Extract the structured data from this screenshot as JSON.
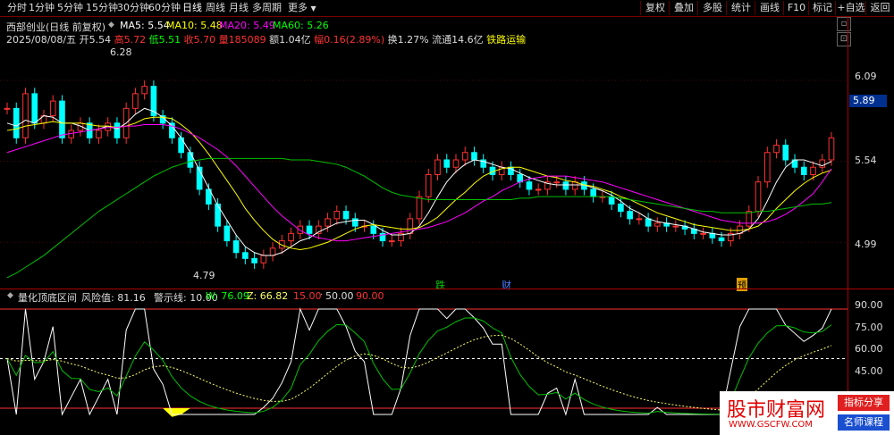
{
  "toolbar": {
    "timeframes": [
      "分时",
      "1分钟",
      "5分钟",
      "15分钟",
      "30分钟",
      "60分钟",
      "日线",
      "周线",
      "月线",
      "多周期",
      "更多"
    ],
    "active_timeframe": "日线",
    "buttons": [
      "复权",
      "叠加",
      "多股",
      "统计",
      "画线",
      "F10",
      "标记",
      "+自选",
      "返回"
    ]
  },
  "main_chart": {
    "stock_title": "西部创业(日线 前复权)",
    "ma_items": [
      {
        "label": "MA5: 5.54",
        "color": "#ffffff"
      },
      {
        "label": "MA10: 5.48",
        "color": "#ffff00"
      },
      {
        "label": "MA20: 5.49",
        "color": "#ff00ff"
      },
      {
        "label": "MA60: 5.26",
        "color": "#00ff00"
      }
    ],
    "info": {
      "date": "2025/08/08/五",
      "open_label": "开",
      "open": "5.54",
      "high_label": "高",
      "high": "5.72",
      "low_label": "低",
      "low": "5.51",
      "close_label": "收",
      "close": "5.70",
      "volume_label": "量",
      "volume": "185089",
      "amount_label": "额",
      "amount": "1.04亿",
      "change_label": "幅",
      "change": "0.16(2.89%)",
      "turnover": "换1.27%",
      "float": "流通14.6亿",
      "sector": "铁路运输"
    },
    "y_ticks": [
      "6.09",
      "5.54",
      "4.99"
    ],
    "current_price": "5.89",
    "high_mark": "6.28",
    "low_mark": "4.79",
    "event_tags": [
      {
        "text": "跌",
        "color": "#00cc00"
      },
      {
        "text": "财",
        "color": "#4a7dff"
      },
      {
        "text": "预",
        "color": "#cc8800"
      }
    ],
    "colors": {
      "up": "#ff3232",
      "down": "#00ffff",
      "ma5": "#ffffff",
      "ma10": "#ffff00",
      "ma20": "#ff00ff",
      "ma60": "#00c000"
    }
  },
  "indicator": {
    "name": "量化顶底区间",
    "risk": "风险值: 81.16",
    "warn": "警示线: 10.00",
    "w": "W: 76.09",
    "z": "Z: 66.82",
    "v15": "15.00",
    "v50": "50.00",
    "v90": "90.00",
    "y_ticks": [
      "90.00",
      "75.00",
      "60.00",
      "45.00"
    ]
  },
  "watermark": {
    "site": "股市财富网",
    "url": "WWW.GSCFW.COM",
    "tag1": "指标分享",
    "tag2": "名师课程"
  },
  "chart_data": {
    "type": "line",
    "title": "西部创业(日线 前复权)",
    "ylim": [
      4.7,
      6.4
    ],
    "close": [
      5.9,
      5.7,
      6.0,
      5.8,
      5.85,
      5.95,
      5.7,
      5.75,
      5.8,
      5.7,
      5.75,
      5.8,
      5.7,
      5.9,
      6.0,
      6.05,
      5.85,
      5.8,
      5.7,
      5.6,
      5.5,
      5.35,
      5.25,
      5.1,
      5.0,
      4.92,
      4.88,
      4.85,
      4.9,
      4.95,
      5.0,
      5.05,
      5.1,
      5.05,
      5.1,
      5.15,
      5.2,
      5.15,
      5.1,
      5.1,
      5.05,
      5.0,
      5.0,
      5.05,
      5.15,
      5.3,
      5.45,
      5.55,
      5.5,
      5.55,
      5.6,
      5.55,
      5.5,
      5.45,
      5.5,
      5.45,
      5.4,
      5.35,
      5.35,
      5.4,
      5.4,
      5.35,
      5.4,
      5.35,
      5.3,
      5.3,
      5.25,
      5.2,
      5.15,
      5.15,
      5.1,
      5.12,
      5.1,
      5.1,
      5.08,
      5.05,
      5.05,
      5.02,
      5.0,
      5.05,
      5.1,
      5.2,
      5.4,
      5.6,
      5.65,
      5.55,
      5.5,
      5.45,
      5.5,
      5.55,
      5.7
    ],
    "series": [
      {
        "name": "MA5",
        "values": [
          5.8,
          5.78,
          5.82,
          5.8,
          5.85,
          5.84,
          5.8,
          5.8,
          5.78,
          5.75,
          5.76,
          5.78,
          5.76,
          5.8,
          5.86,
          5.9,
          5.88,
          5.84,
          5.78,
          5.7,
          5.6,
          5.48,
          5.36,
          5.24,
          5.14,
          5.04,
          4.96,
          4.92,
          4.9,
          4.9,
          4.92,
          4.96,
          5.0,
          5.02,
          5.06,
          5.09,
          5.12,
          5.13,
          5.14,
          5.14,
          5.11,
          5.07,
          5.04,
          5.04,
          5.05,
          5.1,
          5.19,
          5.3,
          5.4,
          5.47,
          5.52,
          5.55,
          5.54,
          5.52,
          5.5,
          5.49,
          5.46,
          5.43,
          5.41,
          5.39,
          5.38,
          5.38,
          5.38,
          5.38,
          5.36,
          5.34,
          5.31,
          5.27,
          5.22,
          5.19,
          5.15,
          5.13,
          5.12,
          5.11,
          5.1,
          5.08,
          5.06,
          5.05,
          5.04,
          5.04,
          5.05,
          5.08,
          5.15,
          5.27,
          5.4,
          5.5,
          5.55,
          5.55,
          5.53,
          5.51,
          5.54
        ]
      },
      {
        "name": "MA10",
        "values": [
          5.75,
          5.76,
          5.78,
          5.79,
          5.8,
          5.81,
          5.8,
          5.8,
          5.8,
          5.79,
          5.78,
          5.78,
          5.77,
          5.78,
          5.8,
          5.83,
          5.84,
          5.84,
          5.83,
          5.79,
          5.74,
          5.67,
          5.59,
          5.5,
          5.41,
          5.32,
          5.22,
          5.14,
          5.07,
          5.01,
          4.97,
          4.95,
          4.94,
          4.95,
          4.97,
          4.99,
          5.02,
          5.05,
          5.08,
          5.1,
          5.11,
          5.1,
          5.09,
          5.08,
          5.08,
          5.09,
          5.12,
          5.16,
          5.22,
          5.28,
          5.33,
          5.39,
          5.44,
          5.47,
          5.49,
          5.5,
          5.5,
          5.48,
          5.46,
          5.44,
          5.43,
          5.41,
          5.4,
          5.38,
          5.37,
          5.35,
          5.33,
          5.3,
          5.28,
          5.25,
          5.22,
          5.19,
          5.17,
          5.15,
          5.13,
          5.11,
          5.1,
          5.09,
          5.08,
          5.07,
          5.07,
          5.08,
          5.1,
          5.15,
          5.22,
          5.28,
          5.34,
          5.39,
          5.43,
          5.46,
          5.48
        ]
      },
      {
        "name": "MA20",
        "values": [
          5.6,
          5.62,
          5.64,
          5.66,
          5.68,
          5.7,
          5.72,
          5.73,
          5.74,
          5.75,
          5.76,
          5.77,
          5.77,
          5.78,
          5.78,
          5.79,
          5.79,
          5.79,
          5.78,
          5.76,
          5.73,
          5.7,
          5.66,
          5.62,
          5.57,
          5.51,
          5.44,
          5.37,
          5.3,
          5.23,
          5.17,
          5.12,
          5.07,
          5.04,
          5.02,
          5.01,
          5.0,
          5.0,
          5.01,
          5.02,
          5.03,
          5.04,
          5.05,
          5.06,
          5.07,
          5.08,
          5.09,
          5.11,
          5.13,
          5.16,
          5.19,
          5.23,
          5.27,
          5.3,
          5.34,
          5.37,
          5.4,
          5.42,
          5.43,
          5.44,
          5.44,
          5.44,
          5.43,
          5.42,
          5.41,
          5.4,
          5.38,
          5.36,
          5.34,
          5.32,
          5.3,
          5.28,
          5.26,
          5.24,
          5.22,
          5.2,
          5.18,
          5.16,
          5.14,
          5.13,
          5.12,
          5.12,
          5.12,
          5.13,
          5.15,
          5.18,
          5.22,
          5.27,
          5.32,
          5.4,
          5.49
        ]
      },
      {
        "name": "MA60",
        "values": [
          4.75,
          4.78,
          4.82,
          4.86,
          4.9,
          4.95,
          5.0,
          5.05,
          5.1,
          5.15,
          5.2,
          5.24,
          5.28,
          5.32,
          5.36,
          5.4,
          5.44,
          5.47,
          5.5,
          5.52,
          5.54,
          5.55,
          5.56,
          5.56,
          5.56,
          5.56,
          5.56,
          5.56,
          5.56,
          5.56,
          5.56,
          5.55,
          5.55,
          5.55,
          5.54,
          5.53,
          5.52,
          5.5,
          5.47,
          5.44,
          5.4,
          5.36,
          5.33,
          5.31,
          5.3,
          5.29,
          5.28,
          5.28,
          5.28,
          5.28,
          5.28,
          5.28,
          5.28,
          5.28,
          5.28,
          5.28,
          5.29,
          5.29,
          5.3,
          5.3,
          5.3,
          5.3,
          5.3,
          5.3,
          5.3,
          5.3,
          5.3,
          5.29,
          5.28,
          5.27,
          5.26,
          5.25,
          5.24,
          5.23,
          5.22,
          5.21,
          5.2,
          5.2,
          5.19,
          5.19,
          5.19,
          5.19,
          5.2,
          5.2,
          5.21,
          5.22,
          5.23,
          5.24,
          5.25,
          5.25,
          5.26
        ]
      }
    ]
  }
}
